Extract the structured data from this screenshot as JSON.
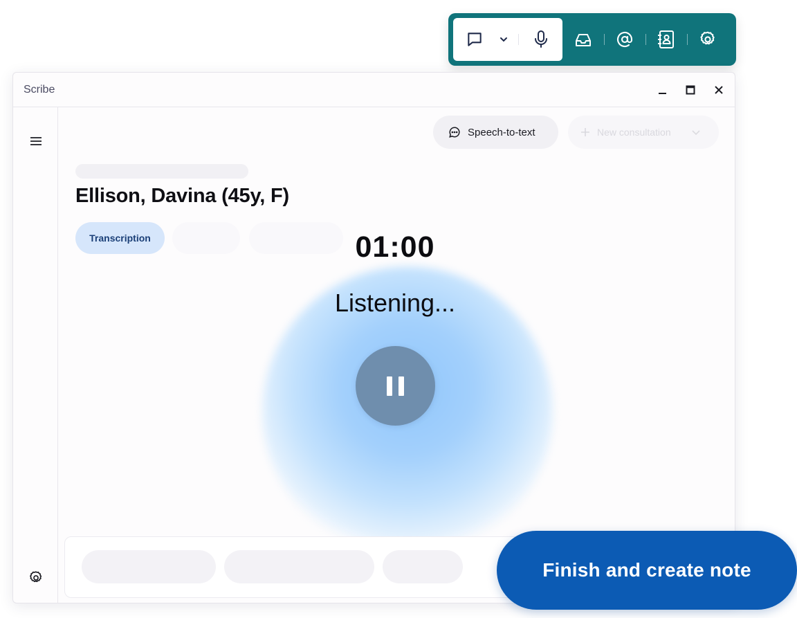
{
  "toolbar": {
    "buttons": [
      {
        "name": "chat-icon"
      },
      {
        "name": "chevron-down-icon"
      },
      {
        "name": "microphone-icon"
      },
      {
        "name": "inbox-icon"
      },
      {
        "name": "at-sign-icon"
      },
      {
        "name": "contacts-icon"
      },
      {
        "name": "settings-gear-icon"
      }
    ],
    "colors": {
      "background": "#10747b",
      "active_segment": "#ffffff",
      "icon_dark": "#1f2a4a",
      "icon_light": "#ffffff"
    }
  },
  "window": {
    "title": "Scribe",
    "controls": [
      "minimize-icon",
      "maximize-icon",
      "close-icon"
    ]
  },
  "sidebar": {
    "top_icon": "menu-icon",
    "bottom_icon": "settings-icon"
  },
  "header": {
    "speech_to_text_label": "Speech-to-text",
    "new_consultation_label": "New consultation"
  },
  "patient": {
    "name": "Ellison, Davina (45y, F)"
  },
  "tabs": {
    "active_label": "Transcription"
  },
  "recording": {
    "timer": "01:00",
    "status": "Listening..."
  },
  "footer": {
    "finish_label": "Finish and create note"
  },
  "colors": {
    "accent": "#0c5bb4",
    "tab_active_bg": "#d6e6fb",
    "orb": "#90c6fb",
    "pause_button": "#6f8ead"
  }
}
